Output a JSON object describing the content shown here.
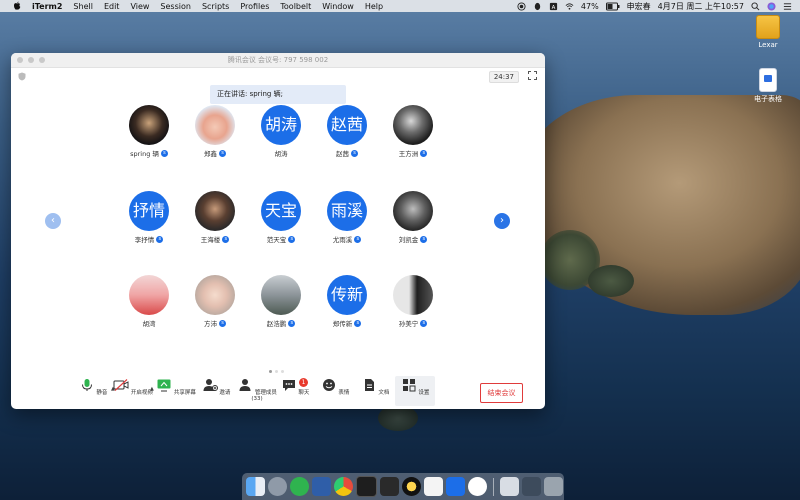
{
  "menubar": {
    "app": "iTerm2",
    "items": [
      "Shell",
      "Edit",
      "View",
      "Session",
      "Scripts",
      "Profiles",
      "Toolbelt",
      "Window",
      "Help"
    ],
    "battery": "47%",
    "user": "申宏春",
    "datetime": "4月7日 周二 上午10:57"
  },
  "desktop": {
    "icons": [
      {
        "label": "Lexar",
        "icon": "drive-icon"
      },
      {
        "label": "电子表格",
        "icon": "document-icon"
      }
    ]
  },
  "meeting": {
    "title": "腾讯会议 会议号: 797 598 002",
    "timer": "24:37",
    "speaking": "正在讲话: spring 辆;",
    "participants": [
      {
        "name": "spring 辆",
        "avatar_text": "",
        "avatar": "photo"
      },
      {
        "name": "郑鑫",
        "avatar_text": "",
        "avatar": "photo"
      },
      {
        "name": "胡涛",
        "avatar_text": "胡涛",
        "avatar": "text"
      },
      {
        "name": "赵茜",
        "avatar_text": "赵茜",
        "avatar": "text"
      },
      {
        "name": "王方洲",
        "avatar_text": "",
        "avatar": "photo"
      },
      {
        "name": "李抒情",
        "avatar_text": "抒情",
        "avatar": "text"
      },
      {
        "name": "王海楼",
        "avatar_text": "",
        "avatar": "photo"
      },
      {
        "name": "范天宝",
        "avatar_text": "天宝",
        "avatar": "text"
      },
      {
        "name": "尤雨溪",
        "avatar_text": "雨溪",
        "avatar": "text"
      },
      {
        "name": "刘凯金",
        "avatar_text": "",
        "avatar": "photo"
      },
      {
        "name": "胡湾",
        "avatar_text": "",
        "avatar": "photo"
      },
      {
        "name": "方沛",
        "avatar_text": "",
        "avatar": "photo"
      },
      {
        "name": "赵浩鹏",
        "avatar_text": "",
        "avatar": "photo"
      },
      {
        "name": "郑传新",
        "avatar_text": "传新",
        "avatar": "text"
      },
      {
        "name": "孙美宁",
        "avatar_text": "",
        "avatar": "photo"
      }
    ],
    "toolbar": {
      "mute": "静音",
      "video": "开启视频",
      "share": "共享屏幕",
      "invite": "邀请",
      "members": "管理成员(33)",
      "chat": "聊天",
      "chat_badge": "1",
      "emoji": "表情",
      "docs": "文档",
      "settings": "设置",
      "end": "结束会议"
    }
  }
}
